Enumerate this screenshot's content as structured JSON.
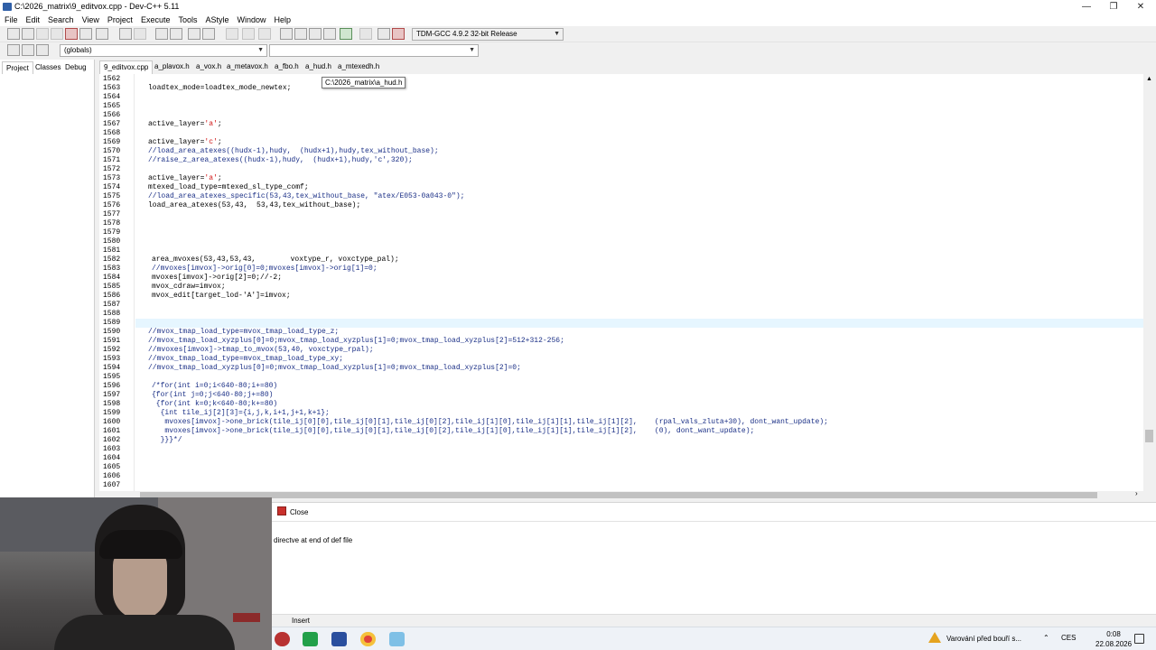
{
  "window": {
    "title": "C:\\2026_matrix\\9_editvox.cpp - Dev-C++ 5.11",
    "controls": [
      "—",
      "❐",
      "✕"
    ]
  },
  "menu": [
    "File",
    "Edit",
    "Search",
    "View",
    "Project",
    "Execute",
    "Tools",
    "AStyle",
    "Window",
    "Help"
  ],
  "toolbar": {
    "compiler_select": "TDM-GCC 4.9.2 32-bit Release",
    "scope_select": "(globals)",
    "function_select": ""
  },
  "side_tabs": [
    "Project",
    "Classes",
    "Debug"
  ],
  "editor_tabs": [
    "9_editvox.cpp",
    "a_plavox.h",
    "a_vox.h",
    "a_metavox.h",
    "a_fbo.h",
    "a_hud.h",
    "a_mtexedh.h"
  ],
  "tooltip": "C:\\2026_matrix\\a_hud.h",
  "code": {
    "line_numbers": [
      "1562",
      "1563",
      "1564",
      "1565",
      "1566",
      "1567",
      "1568",
      "1569",
      "1570",
      "1571",
      "1572",
      "1573",
      "1574",
      "1575",
      "1576",
      "1577",
      "1578",
      "1579",
      "1580",
      "1581",
      "1582",
      "1583",
      "1584",
      "1585",
      "1586",
      "1587",
      "1588",
      "1589",
      "1590",
      "1591",
      "1592",
      "1593",
      "1594",
      "1595",
      "1596",
      "1597",
      "1598",
      "1599",
      "1600",
      "1601",
      "1602",
      "1603",
      "1604",
      "1605",
      "1606",
      "1607"
    ],
    "lines": {
      "l1563": "loadtex_mode=loadtex_mode_newtex;",
      "l1567": "active_layer='a';",
      "l1569": "active_layer='c';",
      "l1570": "//load_area_atexes((hudx-1),hudy,  (hudx+1),hudy,tex_without_base);",
      "l1571": "//raise_z_area_atexes((hudx-1),hudy,  (hudx+1),hudy,'c',320);",
      "l1573": "active_layer='a';",
      "l1574": "mtexed_load_type=mtexed_sl_type_comf;",
      "l1575": "//load_area_atexes_specific(53,43,tex_without_base, \"atex/E053-0a043-0\");",
      "l1576": "load_area_atexes(53,43,  53,43,tex_without_base);",
      "l1582": "area_mvoxes(53,43,53,43,        voxtype_r, voxctype_pal);",
      "l1583": "//mvoxes[imvox]->orig[0]=0;mvoxes[imvox]->orig[1]=0;",
      "l1584": "mvoxes[imvox]->orig[2]=0;//-2;",
      "l1585": "mvox_cdraw=imvox;",
      "l1586": "mvox_edit[target_lod-'A']=imvox;",
      "l1590": "//mvox_tmap_load_type=mvox_tmap_load_type_z;",
      "l1591": "//mvox_tmap_load_xyzplus[0]=0;mvox_tmap_load_xyzplus[1]=0;mvox_tmap_load_xyzplus[2]=512+312-256;",
      "l1592": "//mvoxes[imvox]->tmap_to_mvox(53,40, voxctype_rpal);",
      "l1593": "//mvox_tmap_load_type=mvox_tmap_load_type_xy;",
      "l1594": "//mvox_tmap_load_xyzplus[0]=0;mvox_tmap_load_xyzplus[1]=0;mvox_tmap_load_xyzplus[2]=0;",
      "l1596": "/*for(int i=0;i<640-80;i+=80)",
      "l1597": "{for(int j=0;j<640-80;j+=80)",
      "l1598": " {for(int k=0;k<640-80;k+=80)",
      "l1599": "  {int tile_ij[2][3]={i,j,k,i+1,j+1,k+1};",
      "l1600": "   mvoxes[imvox]->one_brick(tile_ij[0][0],tile_ij[0][1],tile_ij[0][2],tile_ij[1][0],tile_ij[1][1],tile_ij[1][2],    (rpal_vals_zluta+30), dont_want_update);",
      "l1601": "   mvoxes[imvox]->one_brick(tile_ij[0][0],tile_ij[0][1],tile_ij[0][2],tile_ij[1][0],tile_ij[1][1],tile_ij[1][2],    (0), dont_want_update);",
      "l1602": "  }}}*/"
    }
  },
  "bottom_panel": {
    "close_label": "Close",
    "message": "directve at end of def file"
  },
  "status": {
    "mode": "Insert"
  },
  "taskbar": {
    "weather_text": "Varování před bouří s...",
    "language": "CES",
    "time": "0:08",
    "date": "22.08.2026"
  },
  "colors": {
    "accent_current_line": "#e6f6ff",
    "comment": "#1a2f86",
    "string": "#d01414"
  }
}
